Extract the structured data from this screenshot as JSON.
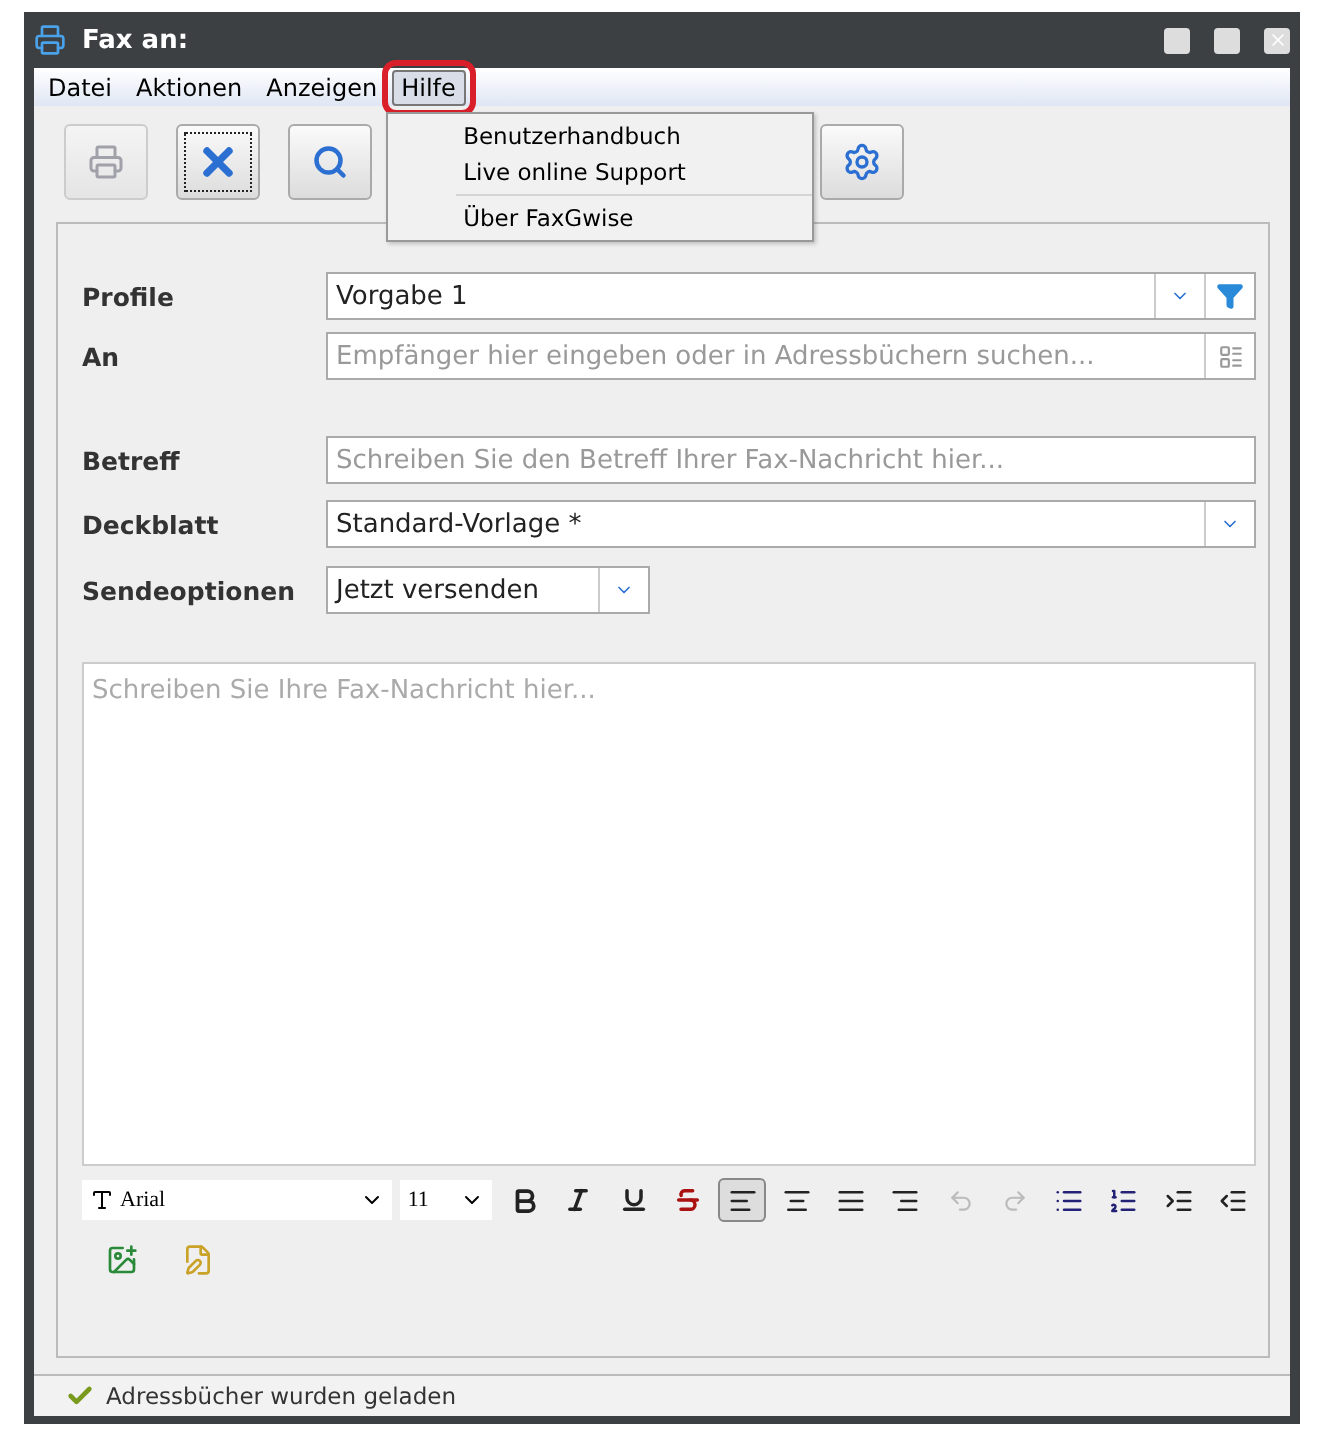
{
  "window": {
    "title": "Fax an:"
  },
  "menus": [
    {
      "label": "Datei",
      "selected": false
    },
    {
      "label": "Aktionen",
      "selected": false
    },
    {
      "label": "Anzeigen",
      "selected": false
    },
    {
      "label": "Hilfe",
      "selected": true
    }
  ],
  "menu_dropdown": {
    "sections": [
      [
        "Benutzerhandbuch",
        "Live online Support"
      ],
      [
        "Über FaxGwise"
      ]
    ]
  },
  "toolbar": [
    {
      "kind": "fax",
      "disabled": true,
      "focused": false
    },
    {
      "kind": "cancel",
      "disabled": false,
      "focused": true
    },
    {
      "kind": "search",
      "disabled": false,
      "focused": false
    },
    {
      "kind": "settings",
      "disabled": false,
      "focused": false
    }
  ],
  "form": {
    "profile": {
      "label": "Profile",
      "value": "Vorgabe 1"
    },
    "to": {
      "label": "An",
      "placeholder": "Empfänger hier eingeben oder in Adressbüchern suchen..."
    },
    "subject": {
      "label": "Betreff",
      "placeholder": "Schreiben Sie den Betreff Ihrer Fax-Nachricht hier..."
    },
    "cover": {
      "label": "Deckblatt",
      "value": "Standard-Vorlage *"
    },
    "send": {
      "label": "Sendeoptionen",
      "value": "Jetzt versenden"
    }
  },
  "editor": {
    "placeholder": "Schreiben Sie Ihre Fax-Nachricht hier..."
  },
  "format_bar": {
    "font": "Arial",
    "size": "11",
    "alignments": [
      {
        "selected": true
      },
      {
        "selected": false
      },
      {
        "selected": false
      },
      {
        "selected": false
      }
    ],
    "history": [
      {
        "disabled": true
      },
      {
        "disabled": true
      }
    ]
  },
  "status_bar": {
    "text": "Adressbücher wurden geladen"
  }
}
